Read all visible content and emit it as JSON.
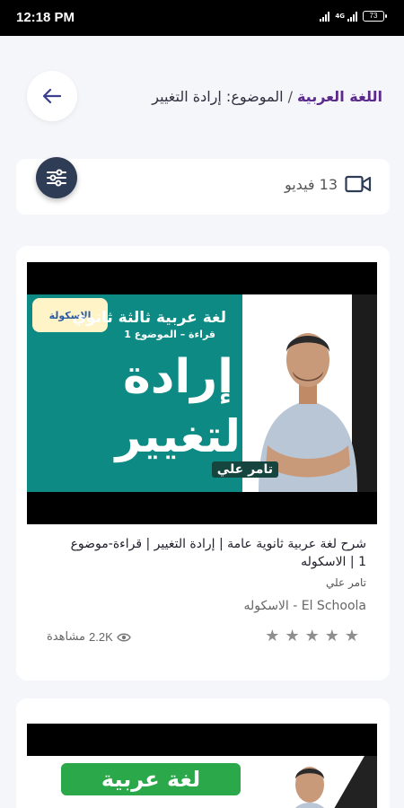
{
  "status_bar": {
    "time": "12:18 PM",
    "network": "4G",
    "battery": "73"
  },
  "header": {
    "back_icon": "arrow-left-icon",
    "subject": "اللغة العربية",
    "separator": "/",
    "topic": "الموضوع: إرادة التغيير"
  },
  "filter_bar": {
    "filter_icon": "sliders-icon",
    "video_icon": "video-camera-icon",
    "count_label": "13 فيديو"
  },
  "videos": [
    {
      "thumbnail": {
        "line1": "لغة عربية ثالثة ثانوي",
        "line2": "قراءة – الموضوع 1",
        "big1": "إرادة",
        "big2": "التغيير",
        "name": "تامر علي",
        "logo": "الاسكولة"
      },
      "title": "شرح لغة عربية ثانوية عامة | إرادة التغيير | قراءة-موضوع 1 | الاسكوله",
      "teacher": "تامر علي",
      "channel": "El Schoola - الاسكوله",
      "rating": 0,
      "rating_max": 5,
      "views": "2.2K",
      "views_label": "مشاهدة"
    },
    {
      "thumbnail": {
        "pill": "لغة عربية"
      }
    }
  ],
  "colors": {
    "accent": "#5b2a8c",
    "filter_button": "#2f3c56",
    "thumbnail_bg": "#0e8a84"
  }
}
